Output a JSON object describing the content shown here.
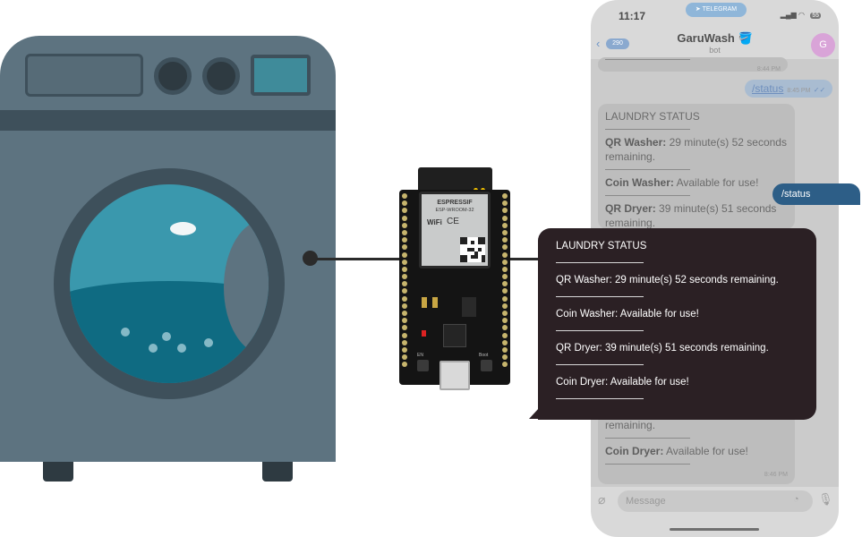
{
  "phone": {
    "time": "11:17",
    "app_pill": "TELEGRAM",
    "battery": "55",
    "back_count": "290",
    "chat_title": "GaruWash",
    "chat_title_emoji": "🪣",
    "chat_subtitle": "bot",
    "avatar_letter": "G",
    "input_placeholder": "Message",
    "messages": {
      "top_time": "8:44 PM",
      "out_command": "/status",
      "out_time": "8:45 PM",
      "status_title": "LAUNDRY STATUS",
      "qr_washer_label": "QR Washer:",
      "qr_washer_value": "29 minute(s) 52 seconds remaining.",
      "coin_washer_label": "Coin Washer:",
      "coin_washer_value": "Available for use!",
      "qr_dryer_label": "QR Dryer:",
      "qr_dryer_value": "39 minute(s) 51 seconds remaining.",
      "tail_remaining": "remaining.",
      "coin_dryer_label": "Coin Dryer:",
      "coin_dryer_value": "Available for use!",
      "bottom_time": "8:46 PM"
    }
  },
  "board": {
    "brand": "ESPRESSIF",
    "model": "ESP-WROOM-32",
    "wifi": "WiFi",
    "ce": "CE",
    "en_label": "EN",
    "boot_label": "Boot"
  },
  "callout": {
    "command": "/status",
    "title": "LAUNDRY STATUS",
    "lines": [
      "QR Washer: 29 minute(s) 52 seconds remaining.",
      "Coin Washer: Available for use!",
      "QR Dryer: 39 minute(s) 51 seconds remaining.",
      "Coin Dryer: Available for use!"
    ]
  }
}
